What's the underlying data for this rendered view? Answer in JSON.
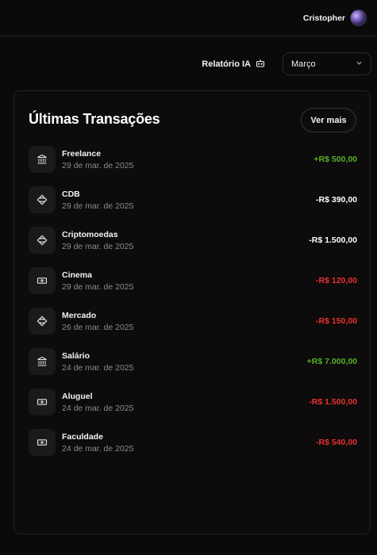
{
  "header": {
    "user_name": "Cristopher"
  },
  "controls": {
    "ai_report_label": "Relatório IA",
    "month_selected": "Março"
  },
  "transactions": {
    "title": "Últimas Transações",
    "see_more_label": "Ver mais",
    "items": [
      {
        "name": "Freelance",
        "date": "29 de mar. de 2025",
        "amount": "+R$ 500,00",
        "kind": "deposit",
        "icon": "bank-icon"
      },
      {
        "name": "CDB",
        "date": "29 de mar. de 2025",
        "amount": "-R$ 390,00",
        "kind": "investment",
        "icon": "investment-icon"
      },
      {
        "name": "Criptomoedas",
        "date": "29 de mar. de 2025",
        "amount": "-R$ 1.500,00",
        "kind": "investment",
        "icon": "investment-icon"
      },
      {
        "name": "Cinema",
        "date": "29 de mar. de 2025",
        "amount": "-R$ 120,00",
        "kind": "expense",
        "icon": "cash-icon"
      },
      {
        "name": "Mercado",
        "date": "26 de mar. de 2025",
        "amount": "-R$ 150,00",
        "kind": "expense",
        "icon": "investment-icon"
      },
      {
        "name": "Salário",
        "date": "24 de mar. de 2025",
        "amount": "+R$ 7.000,00",
        "kind": "deposit",
        "icon": "bank-icon"
      },
      {
        "name": "Aluguel",
        "date": "24 de mar. de 2025",
        "amount": "-R$ 1.500,00",
        "kind": "expense",
        "icon": "cash-icon"
      },
      {
        "name": "Faculdade",
        "date": "24 de mar. de 2025",
        "amount": "-R$ 540,00",
        "kind": "expense",
        "icon": "cash-icon"
      }
    ]
  },
  "colors": {
    "deposit": "#55b02e",
    "expense": "#e93030",
    "investment": "#ffffff",
    "background": "#0b0909"
  }
}
